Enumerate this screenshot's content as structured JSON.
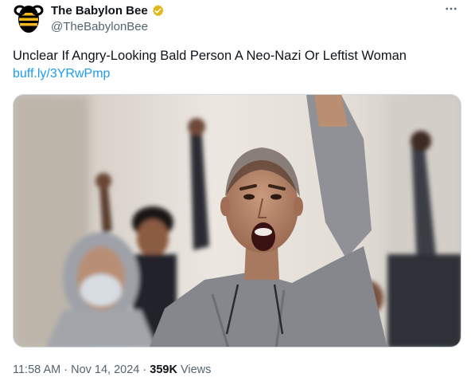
{
  "tweet": {
    "author": {
      "display_name": "The Babylon Bee",
      "handle": "@TheBabylonBee",
      "verified_badge_color": "#e2b719"
    },
    "more_menu_icon": "more-horizontal-icon",
    "text": "Unclear If Angry-Looking Bald Person A Neo-Nazi Or Leftist Woman",
    "link": "buff.ly/3YRwPmp",
    "time": "11:58 AM",
    "separator": "·",
    "date": "Nov 14, 2024",
    "views_count": "359K",
    "views_label": "Views"
  },
  "colors": {
    "link": "#1d9bf0",
    "secondary_text": "#536471",
    "primary_text": "#0f1419"
  }
}
